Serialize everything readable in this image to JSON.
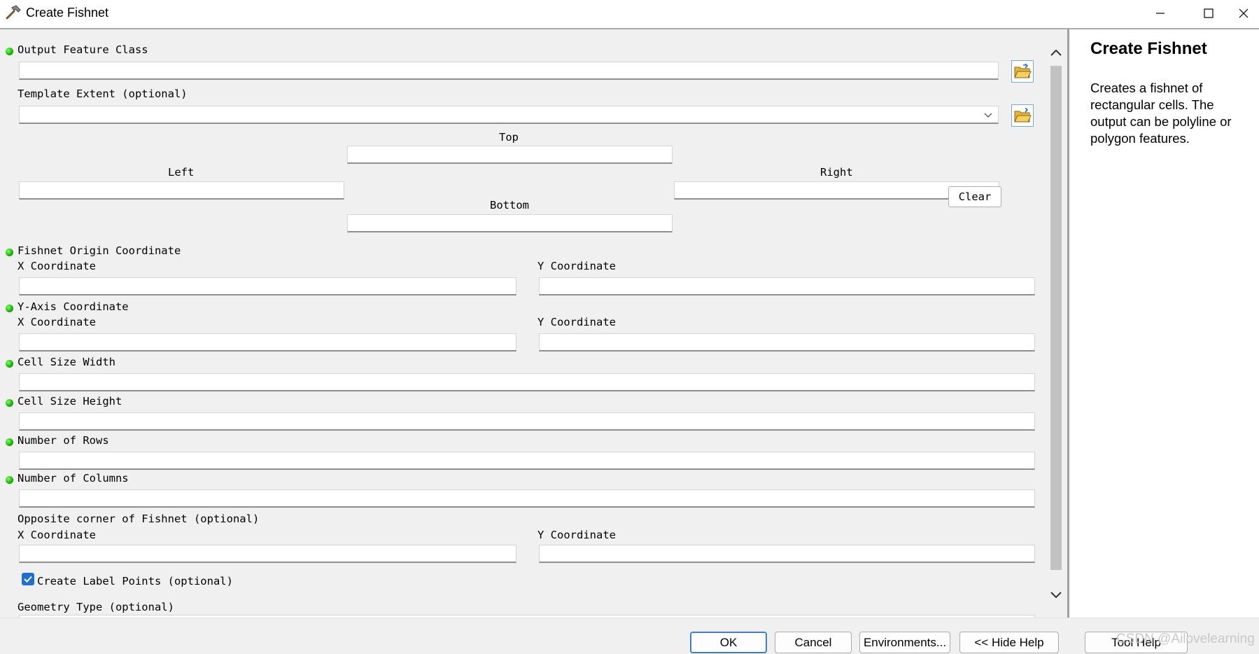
{
  "window": {
    "title": "Create Fishnet"
  },
  "form": {
    "output_feature_class": "Output Feature Class",
    "template_extent": "Template Extent (optional)",
    "extent_top": "Top",
    "extent_left": "Left",
    "extent_right": "Right",
    "extent_bottom": "Bottom",
    "clear_label": "Clear",
    "fishnet_origin": "Fishnet Origin Coordinate",
    "origin_x": "X Coordinate",
    "origin_y": "Y Coordinate",
    "y_axis": "Y-Axis Coordinate",
    "y_axis_x": "X Coordinate",
    "y_axis_y": "Y Coordinate",
    "cell_width": "Cell Size Width",
    "cell_height": "Cell Size Height",
    "num_rows": "Number of Rows",
    "num_columns": "Number of Columns",
    "opposite_corner": "Opposite corner of Fishnet (optional)",
    "corner_x": "X Coordinate",
    "corner_y": "Y Coordinate",
    "label_points": "Create Label Points (optional)",
    "label_points_checked": true,
    "geometry_type": "Geometry Type (optional)"
  },
  "help": {
    "title": "Create Fishnet",
    "body": "Creates a fishnet of rectangular cells. The output can be polyline or polygon features."
  },
  "buttons": {
    "ok": "OK",
    "cancel": "Cancel",
    "environments": "Environments...",
    "hide_help": "<< Hide Help",
    "tool_help": "Tool Help"
  },
  "watermark": "CSDN @Ailovelearning",
  "colors": {
    "required_dot": "#13b000",
    "accent": "#3b7fd4",
    "checkbox": "#1f6fd1"
  }
}
